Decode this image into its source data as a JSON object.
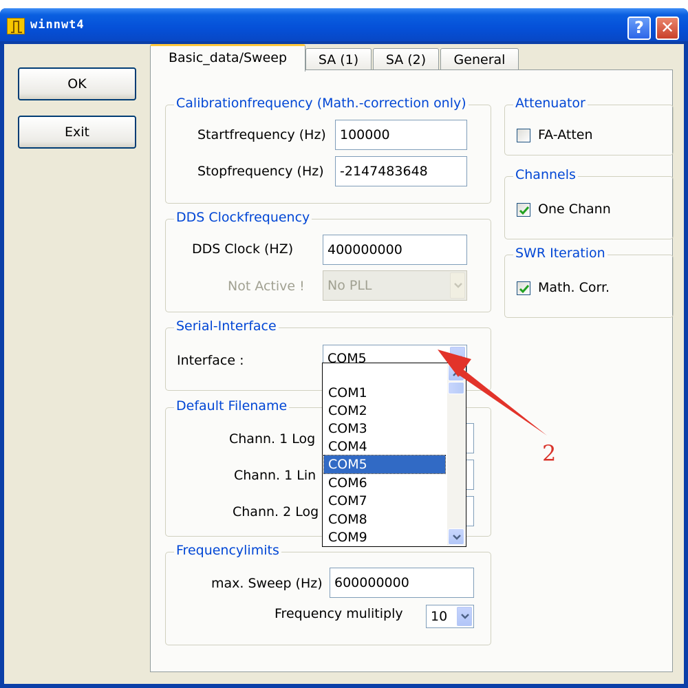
{
  "window": {
    "title": "winnwt4",
    "help_label": "?",
    "close_label": "✕"
  },
  "side_buttons": {
    "ok_label": "OK",
    "exit_label": "Exit"
  },
  "tabs": [
    "Basic_data/Sweep",
    "SA (1)",
    "SA (2)",
    "General"
  ],
  "calibration": {
    "legend": "Calibrationfrequency (Math.-correction only)",
    "start_label": "Startfrequency (Hz)",
    "start_value": "100000",
    "stop_label": "Stopfrequency (Hz)",
    "stop_value": "-2147483648"
  },
  "dds": {
    "legend": "DDS Clockfrequency",
    "clock_label": "DDS Clock (HZ)",
    "clock_value": "400000000",
    "pll_label": "Not Active !",
    "pll_value": "No PLL"
  },
  "serial": {
    "legend": "Serial-Interface",
    "interface_label": "Interface :",
    "interface_value": "COM5",
    "options": [
      "COM1",
      "COM2",
      "COM3",
      "COM4",
      "COM5",
      "COM6",
      "COM7",
      "COM8",
      "COM9"
    ],
    "selected": "COM5"
  },
  "default_filename": {
    "legend": "Default Filename",
    "rows": [
      "Chann. 1  Log",
      "Chann. 1  Lin",
      "Chann. 2 Log"
    ]
  },
  "frequencylimits": {
    "legend": "Frequencylimits",
    "max_sweep_label": "max. Sweep (Hz)",
    "max_sweep_value": "600000000",
    "multiply_label": "Frequency mulitiply",
    "multiply_value": "10"
  },
  "attenuator": {
    "legend": "Attenuator",
    "fa_atten_label": "FA-Atten",
    "fa_atten_checked": false
  },
  "channels": {
    "legend": "Channels",
    "one_chann_label": "One Chann",
    "one_chann_checked": true
  },
  "swr": {
    "legend": "SWR Iteration",
    "math_corr_label": "Math. Corr.",
    "math_corr_checked": true
  },
  "annotation": {
    "number": "2",
    "color": "#d9342b"
  },
  "colors": {
    "title_bar": "#0550d8",
    "legend_text": "#0046d5",
    "selection": "#316ac5",
    "tab_highlight": "#ffc83c"
  },
  "icons": {
    "app": "app-icon",
    "help": "help-icon",
    "close": "close-icon",
    "dropdown": "chevron-down-icon",
    "check": "check-icon"
  }
}
